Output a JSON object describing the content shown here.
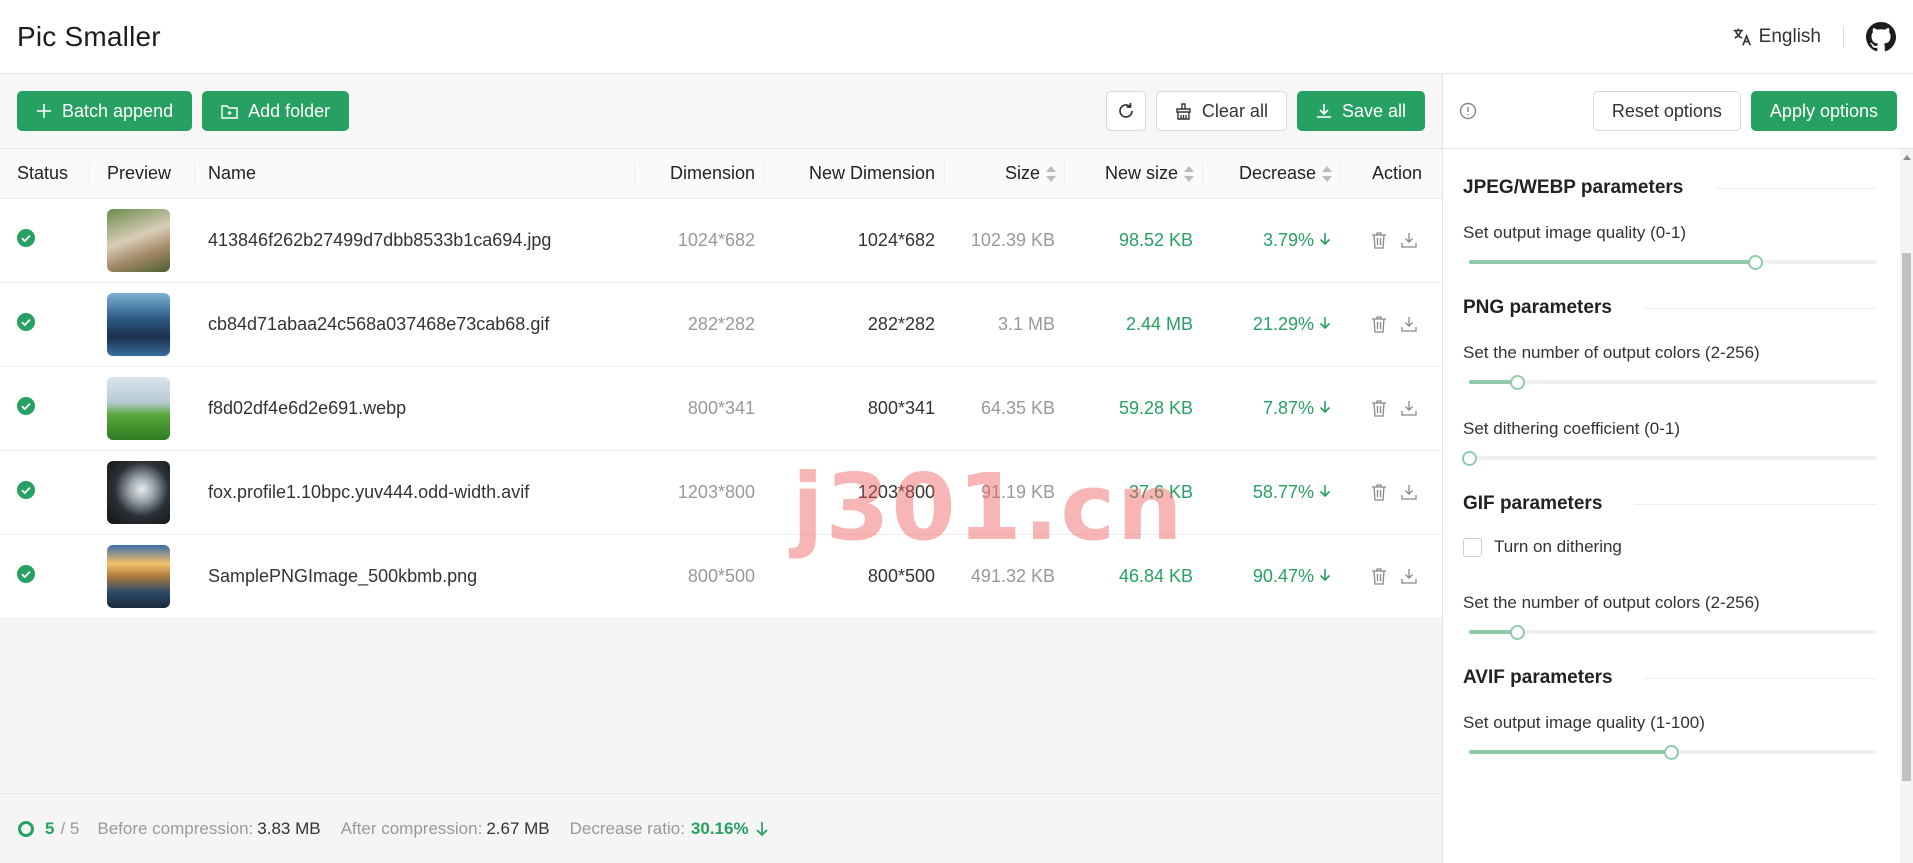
{
  "app": {
    "title": "Pic Smaller",
    "language": "English"
  },
  "toolbar": {
    "batch_append": "Batch append",
    "add_folder": "Add folder",
    "clear_all": "Clear all",
    "save_all": "Save all"
  },
  "table": {
    "headers": {
      "status": "Status",
      "preview": "Preview",
      "name": "Name",
      "dimension": "Dimension",
      "new_dimension": "New Dimension",
      "size": "Size",
      "new_size": "New size",
      "decrease": "Decrease",
      "action": "Action"
    },
    "rows": [
      {
        "name": "413846f262b27499d7dbb8533b1ca694.jpg",
        "dimension": "1024*682",
        "new_dimension": "1024*682",
        "size": "102.39 KB",
        "new_size": "98.52 KB",
        "decrease": "3.79%"
      },
      {
        "name": "cb84d71abaa24c568a037468e73cab68.gif",
        "dimension": "282*282",
        "new_dimension": "282*282",
        "size": "3.1 MB",
        "new_size": "2.44 MB",
        "decrease": "21.29%"
      },
      {
        "name": "f8d02df4e6d2e691.webp",
        "dimension": "800*341",
        "new_dimension": "800*341",
        "size": "64.35 KB",
        "new_size": "59.28 KB",
        "decrease": "7.87%"
      },
      {
        "name": "fox.profile1.10bpc.yuv444.odd-width.avif",
        "dimension": "1203*800",
        "new_dimension": "1203*800",
        "size": "91.19 KB",
        "new_size": "37.6 KB",
        "decrease": "58.77%"
      },
      {
        "name": "SamplePNGImage_500kbmb.png",
        "dimension": "800*500",
        "new_dimension": "800*500",
        "size": "491.32 KB",
        "new_size": "46.84 KB",
        "decrease": "90.47%"
      }
    ]
  },
  "footer": {
    "done": "5",
    "total": "/ 5",
    "before_label": "Before compression:",
    "before_value": "3.83 MB",
    "after_label": "After compression:",
    "after_value": "2.67 MB",
    "ratio_label": "Decrease ratio:",
    "ratio_value": "30.16%"
  },
  "options": {
    "reset": "Reset options",
    "apply": "Apply options",
    "jpeg": {
      "title": "JPEG/WEBP parameters",
      "quality_label": "Set output image quality (0-1)",
      "quality": 0.7
    },
    "png": {
      "title": "PNG parameters",
      "colors_label": "Set the number of output colors (2-256)",
      "colors": 32,
      "dither_label": "Set dithering coefficient (0-1)",
      "dither": 0
    },
    "gif": {
      "title": "GIF parameters",
      "dither_toggle": "Turn on dithering",
      "dither_on": false,
      "colors_label": "Set the number of output colors (2-256)",
      "colors": 32
    },
    "avif": {
      "title": "AVIF parameters",
      "quality_label": "Set output image quality (1-100)",
      "quality": 50
    }
  },
  "watermark": "j301.cn",
  "colors": {
    "accent": "#26a162",
    "slider": "#8fcbaa"
  }
}
